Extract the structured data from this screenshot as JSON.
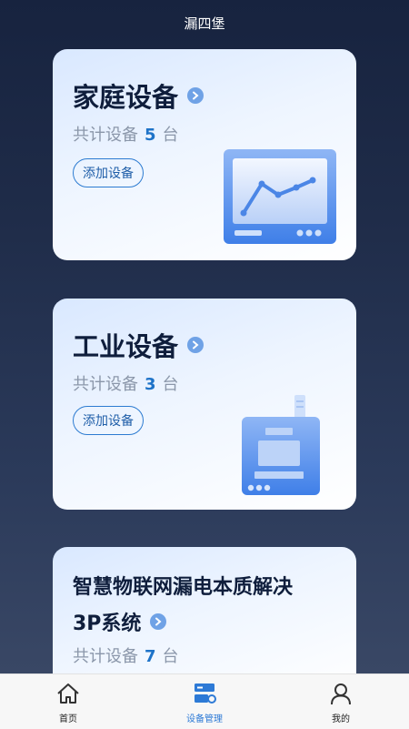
{
  "header": {
    "title": "漏四堡"
  },
  "cards": [
    {
      "title": "家庭设备",
      "count_prefix": "共计设备",
      "count": "5",
      "count_unit": "台",
      "add_label": "添加设备",
      "illustration": "monitor-chart-icon"
    },
    {
      "title": "工业设备",
      "count_prefix": "共计设备",
      "count": "3",
      "count_unit": "台",
      "add_label": "添加设备",
      "illustration": "industrial-device-icon"
    },
    {
      "title_line1": "智慧物联网漏电本质解决",
      "title_line2": "3P系统",
      "count_prefix": "共计设备",
      "count": "7",
      "count_unit": "台"
    }
  ],
  "tabbar": {
    "items": [
      {
        "label": "首页",
        "icon": "home-icon"
      },
      {
        "label": "设备管理",
        "icon": "device-manage-icon",
        "active": true
      },
      {
        "label": "我的",
        "icon": "user-icon"
      }
    ]
  },
  "colors": {
    "accent": "#2d7ad6",
    "count_number": "#1e73c8",
    "title": "#0f1e3c"
  }
}
